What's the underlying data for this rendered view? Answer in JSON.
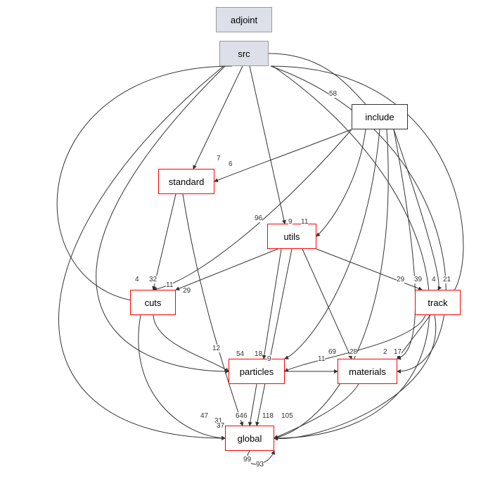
{
  "nodes": {
    "adjoint": {
      "label": "adjoint"
    },
    "src": {
      "label": "src"
    },
    "include": {
      "label": "include"
    },
    "standard": {
      "label": "standard"
    },
    "utils": {
      "label": "utils"
    },
    "cuts": {
      "label": "cuts"
    },
    "track": {
      "label": "track"
    },
    "particles": {
      "label": "particles"
    },
    "materials": {
      "label": "materials"
    },
    "global": {
      "label": "global"
    }
  },
  "edge_labels": {
    "src_include": "58",
    "src_standard_7": "7",
    "src_standard_6": "6",
    "src_utils_96": "96",
    "src_utils_9": "9",
    "src_utils_11": "11",
    "cuts_4": "4",
    "cuts_32": "32",
    "cuts_11": "11",
    "cuts_29": "29",
    "track_29": "29",
    "track_39": "39",
    "track_4": "4",
    "track_21": "21",
    "particles_12": "12",
    "particles_54": "54",
    "particles_18": "18",
    "particles_9": "9",
    "particles_11": "11",
    "materials_69": "69",
    "materials_28": "28",
    "materials_2": "2",
    "materials_17": "17",
    "global_47": "47",
    "global_31": "31",
    "global_37": "37",
    "global_646": "646",
    "global_118": "118",
    "global_105": "105",
    "global_99": "99",
    "global_93": "93"
  }
}
